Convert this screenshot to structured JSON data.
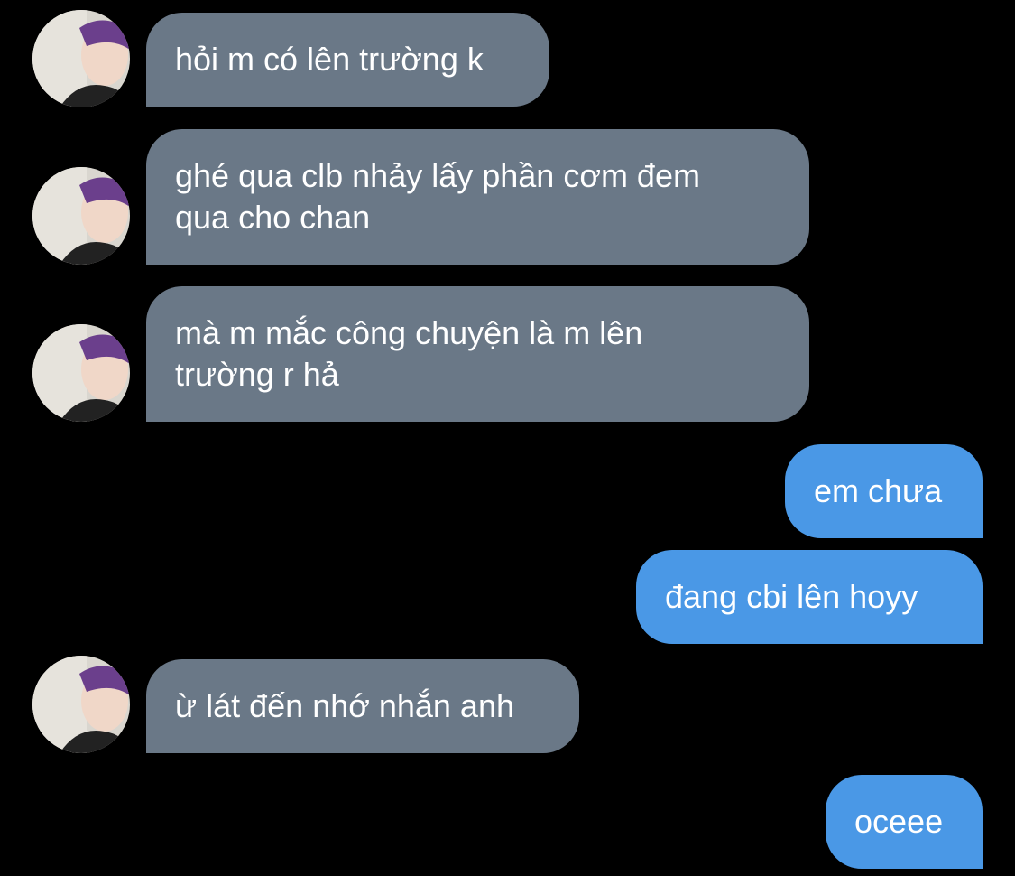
{
  "colors": {
    "background": "#000000",
    "incoming_bubble": "#6a7887",
    "outgoing_bubble": "#4a98e6",
    "text": "#ffffff"
  },
  "messages": [
    {
      "direction": "incoming",
      "text": "hỏi m có lên trường k",
      "avatar": "avatar-photo"
    },
    {
      "direction": "incoming",
      "text": "ghé qua clb nhảy lấy phần cơm đem\nqua cho chan",
      "avatar": "avatar-photo"
    },
    {
      "direction": "incoming",
      "text": "mà m mắc công chuyện là m lên\ntrường r hả",
      "avatar": "avatar-photo"
    },
    {
      "direction": "outgoing",
      "text": "em chưa"
    },
    {
      "direction": "outgoing",
      "text": "đang cbi lên hoyy"
    },
    {
      "direction": "incoming",
      "text": "ừ lát đến nhớ nhắn anh",
      "avatar": "avatar-photo"
    },
    {
      "direction": "outgoing",
      "text": "oceee"
    }
  ]
}
